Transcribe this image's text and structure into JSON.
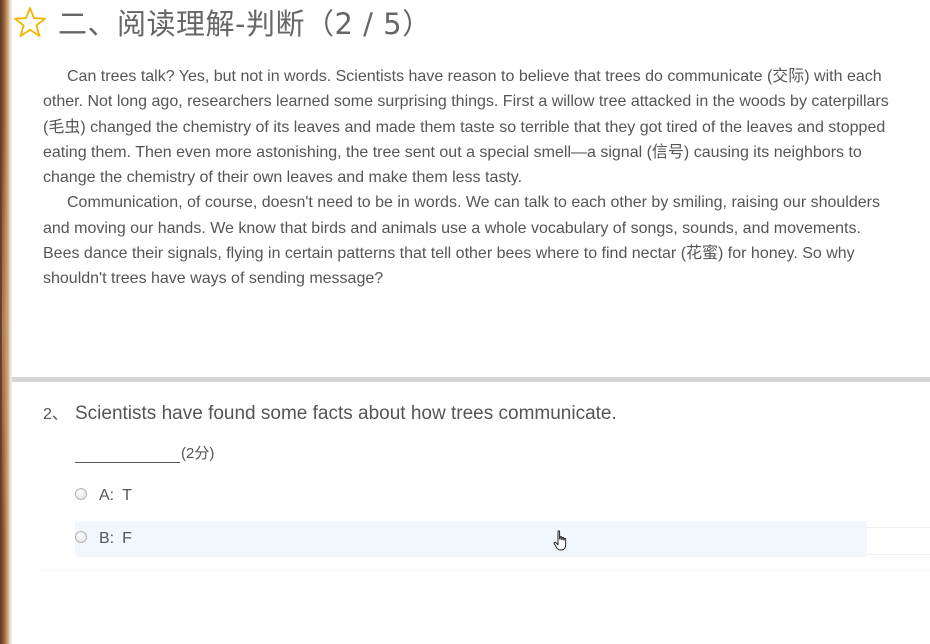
{
  "header": {
    "star_icon": "star-outline-icon",
    "title": "二、阅读理解-判断（2 / 5）"
  },
  "passage": {
    "paragraphs": [
      "Can trees talk? Yes, but not in words. Scientists have reason to believe that trees do communicate (交际) with each other. Not long ago, researchers learned some surprising things. First a willow tree attacked in the woods by caterpillars (毛虫) changed the chemistry of its leaves and made them taste so terrible that they got tired of the leaves and stopped eating them. Then even more astonishing, the tree sent out a special smell—a signal (信号) causing its neighbors to change the chemistry of their own leaves and make them less tasty.",
      "Communication, of course, doesn't need to be in words. We can talk to each other by smiling, raising our shoulders and moving our hands. We know that birds and animals use a whole vocabulary of songs, sounds, and movements. Bees dance their signals, flying in certain patterns that tell other bees where to find nectar (花蜜) for honey. So why shouldn't trees have ways of sending message?"
    ]
  },
  "question": {
    "number": "2、",
    "text": "Scientists have found some facts about how trees communicate.",
    "score": "(2分)",
    "options": [
      {
        "key": "A:",
        "value": "T"
      },
      {
        "key": "B:",
        "value": "F"
      }
    ]
  },
  "colors": {
    "star": "#f5b400",
    "text": "#555555",
    "divider": "#d6d6d6",
    "hover_row": "#f1f7fd"
  }
}
